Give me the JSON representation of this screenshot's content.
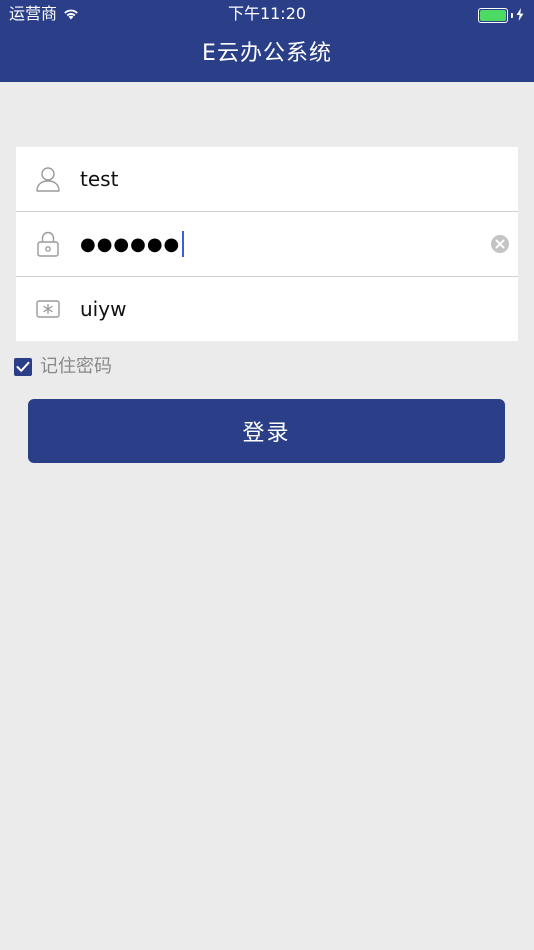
{
  "status_bar": {
    "carrier": "运营商",
    "time": "下午11:20",
    "battery_level": 1.0,
    "battery_color": "#4cd964"
  },
  "header": {
    "title": "E云办公系统",
    "background_color": "#2b3f88"
  },
  "form": {
    "username": {
      "icon": "user-icon",
      "value": "test"
    },
    "password": {
      "icon": "lock-icon",
      "masked_value": "●●●●●●",
      "clear_icon": "clear-icon"
    },
    "captcha": {
      "icon": "asterisk-box-icon",
      "value": "uiyw"
    }
  },
  "remember": {
    "label": "记住密码",
    "checked": true
  },
  "login_button": {
    "label": "登录"
  }
}
